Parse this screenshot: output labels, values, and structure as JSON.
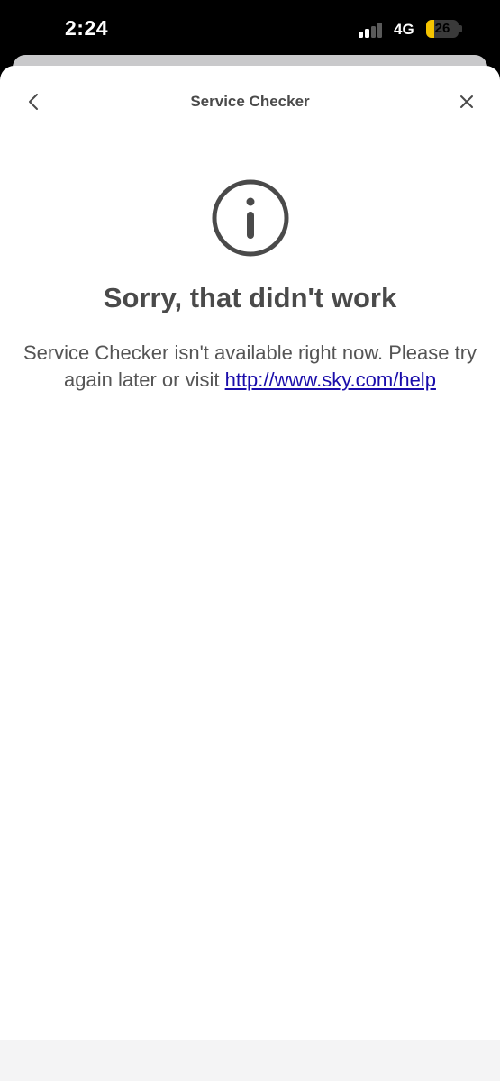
{
  "status_bar": {
    "time": "2:24",
    "network": "4G",
    "battery_level": "26",
    "battery_fraction": 0.26,
    "signal_bars_active": 2,
    "signal_bars_total": 4,
    "battery_fill_color": "#f5c400"
  },
  "header": {
    "back_icon": "chevron-left-icon",
    "title": "Service Checker",
    "close_icon": "close-icon"
  },
  "main": {
    "icon": "info-icon",
    "title": "Sorry, that didn't work",
    "message": "Service Checker isn't available right now. Please try again later or visit",
    "link_text": "http://www.sky.com/help",
    "link_color": "#1a0dab"
  }
}
